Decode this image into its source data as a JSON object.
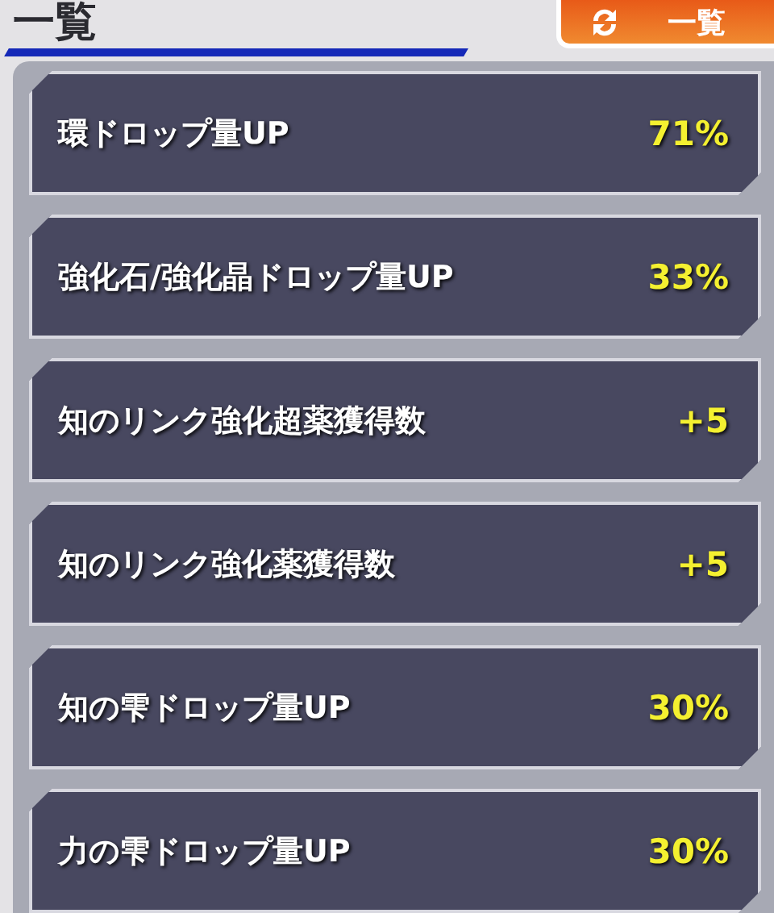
{
  "header": {
    "title": "一覧",
    "button": {
      "label": "一覧"
    }
  },
  "bonuses": [
    {
      "name": "環ドロップ量UP",
      "value": "71%"
    },
    {
      "name": "強化石/強化晶ドロップ量UP",
      "value": "33%"
    },
    {
      "name": "知のリンク強化超薬獲得数",
      "value": "+5"
    },
    {
      "name": "知のリンク強化薬獲得数",
      "value": "+5"
    },
    {
      "name": "知の雫ドロップ量UP",
      "value": "30%"
    },
    {
      "name": "力の雫ドロップ量UP",
      "value": "30%"
    }
  ]
}
